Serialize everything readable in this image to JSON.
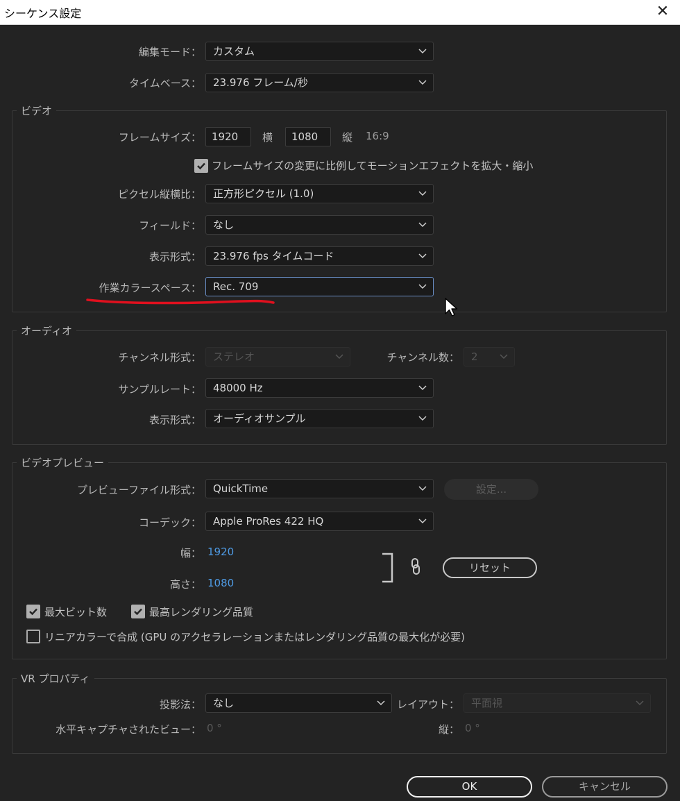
{
  "window": {
    "title": "シーケンス設定"
  },
  "general": {
    "edit_mode_label": "編集モード：",
    "edit_mode_value": "カスタム",
    "timebase_label": "タイムベース：",
    "timebase_value": "23.976  フレーム/秒"
  },
  "video": {
    "legend": "ビデオ",
    "frame_size_label": "フレームサイズ：",
    "width": "1920",
    "width_label": "横",
    "height": "1080",
    "height_label": "縦",
    "aspect": "16:9",
    "scale_checkbox_label": "フレームサイズの変更に比例してモーションエフェクトを拡大・縮小",
    "pixel_aspect_label": "ピクセル縦横比：",
    "pixel_aspect_value": "正方形ピクセル (1.0)",
    "fields_label": "フィールド：",
    "fields_value": "なし",
    "display_format_label": "表示形式：",
    "display_format_value": "23.976  fps タイムコード",
    "color_space_label": "作業カラースペース：",
    "color_space_value": "Rec. 709"
  },
  "audio": {
    "legend": "オーディオ",
    "channel_format_label": "チャンネル形式：",
    "channel_format_value": "ステレオ",
    "channel_count_label": "チャンネル数：",
    "channel_count_value": "2",
    "sample_rate_label": "サンプルレート：",
    "sample_rate_value": "48000 Hz",
    "display_format_label": "表示形式：",
    "display_format_value": "オーディオサンプル"
  },
  "preview": {
    "legend": "ビデオプレビュー",
    "file_format_label": "プレビューファイル形式：",
    "file_format_value": "QuickTime",
    "settings_button": "設定...",
    "codec_label": "コーデック：",
    "codec_value": "Apple ProRes 422 HQ",
    "width_label": "幅：",
    "width_value": "1920",
    "height_label": "高さ：",
    "height_value": "1080",
    "reset_button": "リセット",
    "max_bit_depth_label": "最大ビット数",
    "max_render_quality_label": "最高レンダリング品質",
    "linear_color_label": "リニアカラーで合成 (GPU のアクセラレーションまたはレンダリング品質の最大化が必要)"
  },
  "vr": {
    "legend": "VR プロパティ",
    "projection_label": "投影法：",
    "projection_value": "なし",
    "layout_label": "レイアウト：",
    "layout_value": "平面視",
    "horizontal_view_label": "水平キャプチャされたビュー：",
    "horizontal_view_value": "0 °",
    "vertical_label": "縦：",
    "vertical_value": "0 °"
  },
  "footer": {
    "ok": "OK",
    "cancel": "キャンセル"
  },
  "colors": {
    "accent_link": "#4f9be4",
    "annotation": "#e0101e",
    "background": "#232323"
  }
}
